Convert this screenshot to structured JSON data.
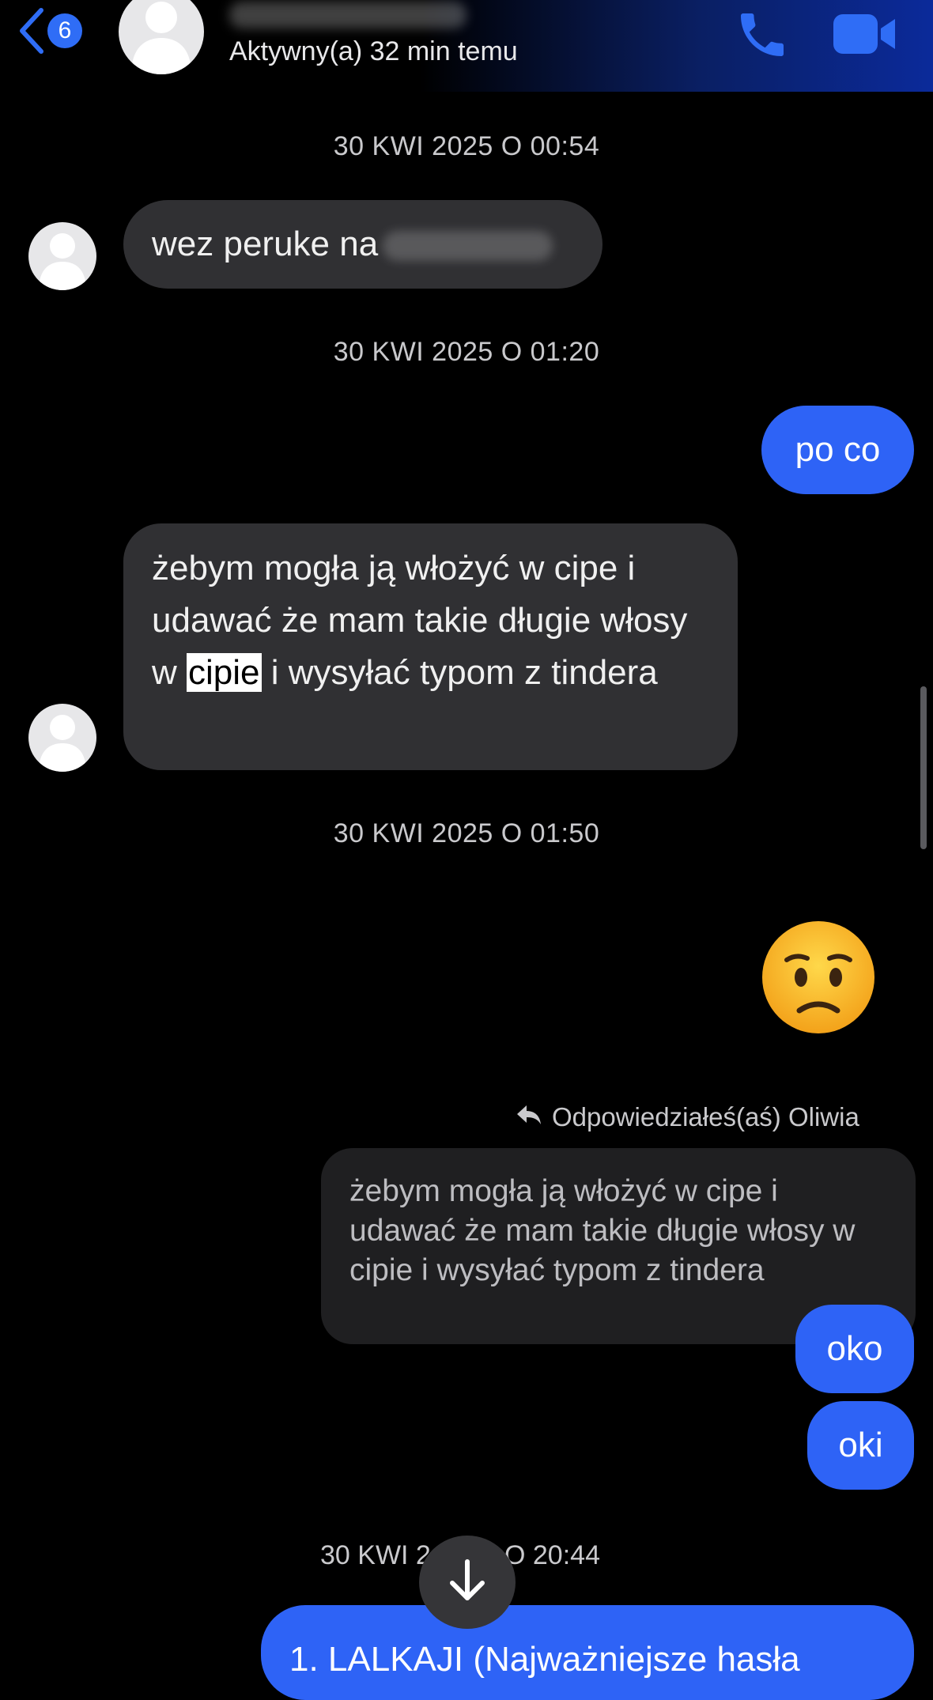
{
  "header": {
    "back_count": "6",
    "status": "Aktywny(a) 32 min temu"
  },
  "colors": {
    "accent": "#2e63f6",
    "incoming_bubble": "#303033",
    "background": "#000000"
  },
  "messages": {
    "ts1": "30 KWI 2025 O 00:54",
    "m1_text": "wez peruke na",
    "ts2": "30 KWI 2025 O 01:20",
    "m2_text": "po co",
    "m3_part1": "żebym mogła ją włożyć w cipe i udawać że mam takie długie włosy w ",
    "m3_highlight": "cipie",
    "m3_part2": " i wysyłać typom z tindera",
    "ts3": "30 KWI 2025 O 01:50",
    "m4_emoji": "😟",
    "reply_label": "Odpowiedziałeś(aś) Oliwia",
    "reply_quote": "żebym mogła ją włożyć w cipe i udawać że mam takie długie włosy w cipie i wysyłać typom z tindera",
    "m5_text": "oko",
    "m6_text": "oki",
    "ts4_left": "30 KWI 2",
    "ts4_right": "O 20:44",
    "m7_text": "1. LALKAJI (Najważniejsze hasła"
  },
  "icons": {
    "back": "chevron-left-icon",
    "call": "phone-icon",
    "video": "video-camera-icon",
    "reply": "reply-arrow-icon",
    "scroll_down": "arrow-down-icon"
  }
}
